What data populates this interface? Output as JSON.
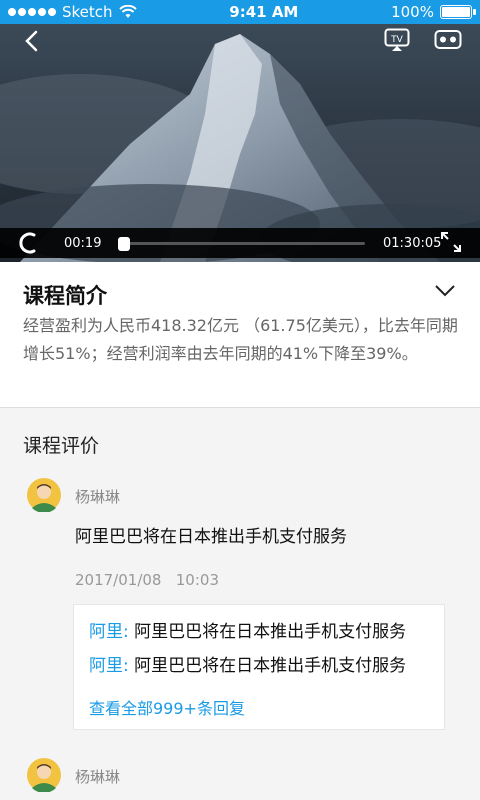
{
  "status": {
    "carrier": "Sketch",
    "time": "9:41 AM",
    "battery": "100%"
  },
  "video": {
    "current_time": "00:19",
    "total_time": "01:30:05",
    "progress_fraction": 0.0035
  },
  "intro": {
    "title": "课程简介",
    "description": "经营盈利为人民币418.32亿元 （61.75亿美元），比去年同期增长51%；经营利润率由去年同期的41%下降至39%。"
  },
  "reviews": {
    "title": "课程评价",
    "items": [
      {
        "name": "杨琳琳",
        "text": "阿里巴巴将在日本推出手机支付服务",
        "time": "2017/01/08   10:03",
        "replies": [
          {
            "who": "阿里:",
            "text": " 阿里巴巴将在日本推出手机支付服务"
          },
          {
            "who": "阿里:",
            "text": " 阿里巴巴将在日本推出手机支付服务"
          }
        ],
        "more_label": "查看全部999+条回复"
      },
      {
        "name": "杨琳琳"
      }
    ]
  },
  "colors": {
    "accent": "#1a9be6",
    "background": "#f4f4f4"
  }
}
